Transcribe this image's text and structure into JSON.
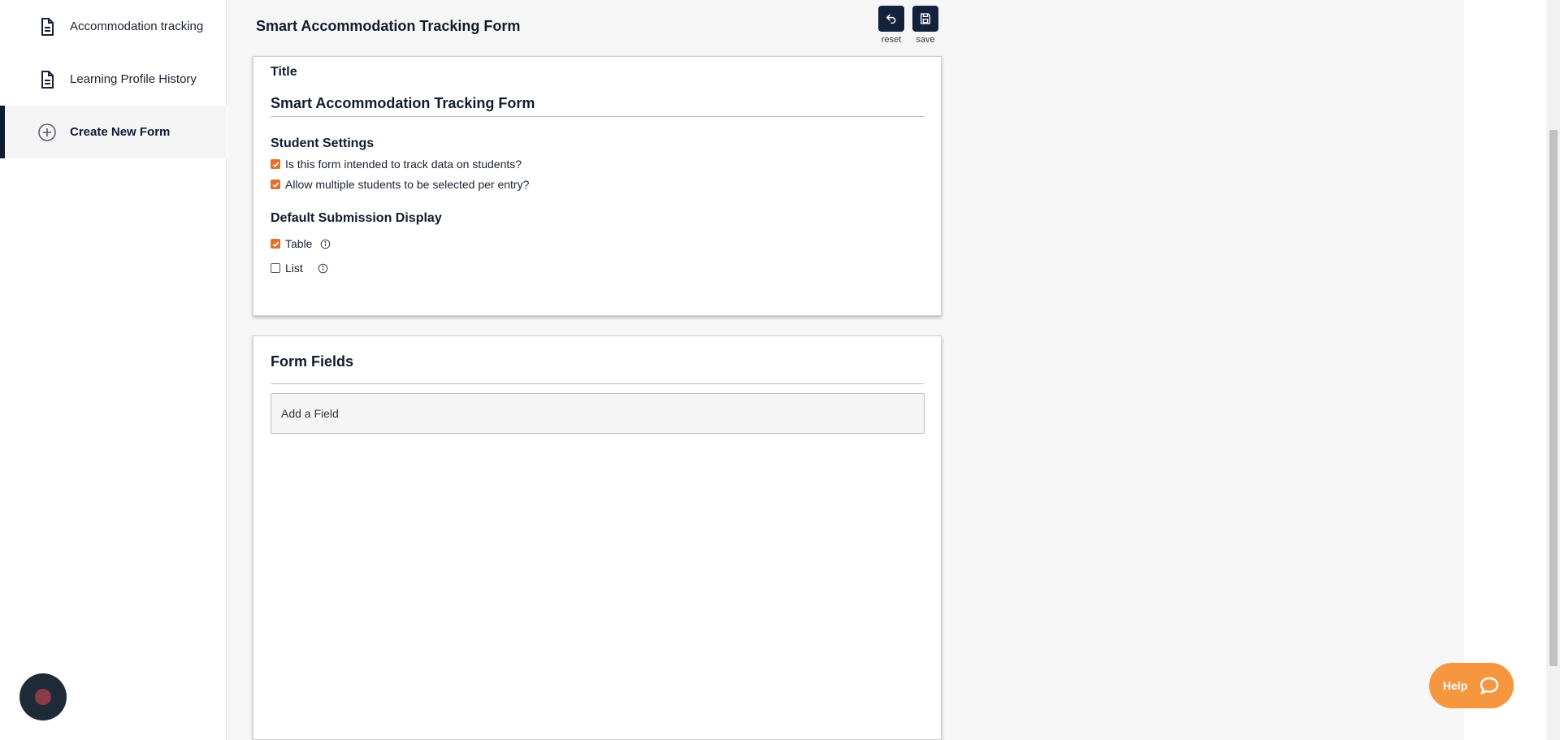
{
  "sidebar": {
    "items": [
      {
        "label": "Accommodation tracking",
        "icon": "document-icon",
        "active": false
      },
      {
        "label": "Learning Profile History",
        "icon": "document-icon",
        "active": false
      },
      {
        "label": "Create New Form",
        "icon": "plus-circle-icon",
        "active": true
      }
    ]
  },
  "header": {
    "title": "Smart Accommodation Tracking Form",
    "reset_label": "reset",
    "save_label": "save"
  },
  "settings": {
    "title_label": "Title",
    "title_value": "Smart Accommodation Tracking Form",
    "student_settings": {
      "heading": "Student Settings",
      "options": [
        {
          "label": "Is this form intended to track data on students?",
          "checked": true
        },
        {
          "label": "Allow multiple students to be selected per entry?",
          "checked": true
        }
      ]
    },
    "default_display": {
      "heading": "Default Submission Display",
      "options": [
        {
          "label": "Table",
          "checked": true
        },
        {
          "label": "List",
          "checked": false
        }
      ]
    }
  },
  "form_fields": {
    "heading": "Form Fields",
    "add_field_label": "Add a Field"
  },
  "help": {
    "label": "Help"
  },
  "colors": {
    "accent": "#e0712c",
    "navy": "#13213c",
    "help": "#f6973f"
  }
}
